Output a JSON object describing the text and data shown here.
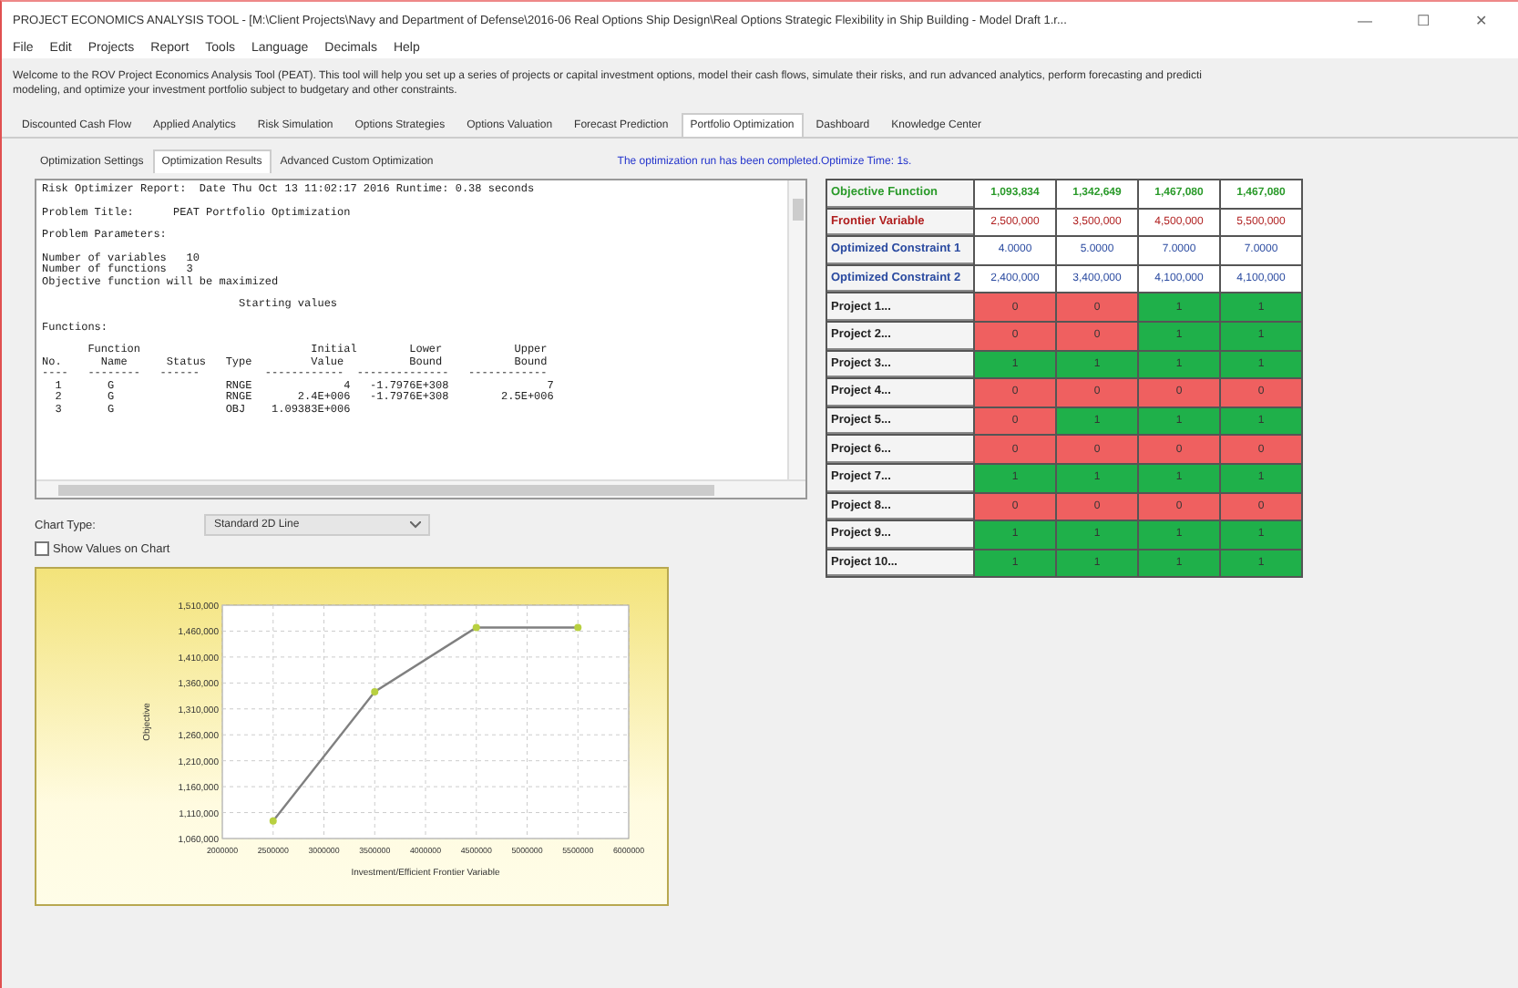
{
  "window": {
    "title": "PROJECT ECONOMICS ANALYSIS TOOL - [M:\\Client Projects\\Navy and Department of Defense\\2016-06 Real Options Ship Design\\Real Options Strategic Flexibility in Ship Building - Model Draft 1.r...",
    "controls": [
      "—",
      "☐",
      "✕"
    ]
  },
  "menu": [
    "File",
    "Edit",
    "Projects",
    "Report",
    "Tools",
    "Language",
    "Decimals",
    "Help"
  ],
  "welcome": [
    "Welcome to the ROV Project Economics Analysis Tool (PEAT). This tool will help you set up a series of projects or capital investment options, model their cash flows, simulate their risks, and run advanced analytics, perform forecasting and predicti",
    "modeling, and optimize your investment portfolio subject to budgetary and other constraints."
  ],
  "tabs": [
    {
      "label": "Discounted Cash Flow",
      "selected": false
    },
    {
      "label": "Applied Analytics",
      "selected": false
    },
    {
      "label": "Risk Simulation",
      "selected": false
    },
    {
      "label": "Options Strategies",
      "selected": false
    },
    {
      "label": "Options Valuation",
      "selected": false
    },
    {
      "label": "Forecast Prediction",
      "selected": false
    },
    {
      "label": "Portfolio Optimization",
      "selected": true
    },
    {
      "label": "Dashboard",
      "selected": false
    },
    {
      "label": "Knowledge Center",
      "selected": false
    }
  ],
  "subtabs": [
    {
      "label": "Optimization Settings",
      "selected": false
    },
    {
      "label": "Optimization Results",
      "selected": true
    },
    {
      "label": "Advanced Custom Optimization",
      "selected": false
    }
  ],
  "status_message": "The optimization run has been completed.Optimize Time: 1s.",
  "report": [
    [
      "Risk Optimizer Report:  Date Thu Oct 13 11:02:17 2016 Runtime: 0.38 seconds"
    ],
    [
      "Problem Title:      PEAT Portfolio Optimization"
    ],
    [
      "Problem Parameters:"
    ],
    [
      "Number of variables   10",
      "Number of functions   3",
      "Objective function will be maximized"
    ],
    [
      "                              Starting values"
    ],
    [
      "Functions:"
    ],
    [
      "       Function                          Initial        Lower           Upper",
      "No.      Name      Status   Type         Value          Bound           Bound",
      "----   --------   ------          ------------  --------------   ------------",
      "  1       G                 RNGE              4   -1.7976E+308               7",
      "  2       G                 RNGE       2.4E+006   -1.7976E+308        2.5E+006",
      "  3       G                 OBJ    1.09383E+006"
    ]
  ],
  "chart_type": {
    "label": "Chart Type:",
    "value": "Standard 2D Line"
  },
  "show_values": {
    "label": "Show Values on Chart",
    "checked": false
  },
  "results": {
    "header_rows": [
      {
        "kind": "objective",
        "label": "Objective Function",
        "values": [
          "1,093,834",
          "1,342,649",
          "1,467,080",
          "1,467,080"
        ]
      },
      {
        "kind": "frontier",
        "label": "Frontier Variable",
        "values": [
          "2,500,000",
          "3,500,000",
          "4,500,000",
          "5,500,000"
        ]
      },
      {
        "kind": "constraint",
        "label": "Optimized Constraint 1",
        "values": [
          "4.0000",
          "5.0000",
          "7.0000",
          "7.0000"
        ]
      },
      {
        "kind": "constraint",
        "label": "Optimized Constraint 2",
        "values": [
          "2,400,000",
          "3,400,000",
          "4,100,000",
          "4,100,000"
        ]
      }
    ],
    "projects": [
      {
        "label": "Project 1...",
        "cells": [
          {
            "value": "0",
            "included": false
          },
          {
            "value": "0",
            "included": false
          },
          {
            "value": "1",
            "included": true
          },
          {
            "value": "1",
            "included": true
          }
        ]
      },
      {
        "label": "Project 2...",
        "cells": [
          {
            "value": "0",
            "included": false
          },
          {
            "value": "0",
            "included": false
          },
          {
            "value": "1",
            "included": true
          },
          {
            "value": "1",
            "included": true
          }
        ]
      },
      {
        "label": "Project 3...",
        "cells": [
          {
            "value": "1",
            "included": true
          },
          {
            "value": "1",
            "included": true
          },
          {
            "value": "1",
            "included": true
          },
          {
            "value": "1",
            "included": true
          }
        ]
      },
      {
        "label": "Project 4...",
        "cells": [
          {
            "value": "0",
            "included": false
          },
          {
            "value": "0",
            "included": false
          },
          {
            "value": "0",
            "included": false
          },
          {
            "value": "0",
            "included": false
          }
        ]
      },
      {
        "label": "Project 5...",
        "cells": [
          {
            "value": "0",
            "included": false
          },
          {
            "value": "1",
            "included": true
          },
          {
            "value": "1",
            "included": true
          },
          {
            "value": "1",
            "included": true
          }
        ]
      },
      {
        "label": "Project 6...",
        "cells": [
          {
            "value": "0",
            "included": false
          },
          {
            "value": "0",
            "included": false
          },
          {
            "value": "0",
            "included": false
          },
          {
            "value": "0",
            "included": false
          }
        ]
      },
      {
        "label": "Project 7...",
        "cells": [
          {
            "value": "1",
            "included": true
          },
          {
            "value": "1",
            "included": true
          },
          {
            "value": "1",
            "included": true
          },
          {
            "value": "1",
            "included": true
          }
        ]
      },
      {
        "label": "Project 8...",
        "cells": [
          {
            "value": "0",
            "included": false
          },
          {
            "value": "0",
            "included": false
          },
          {
            "value": "0",
            "included": false
          },
          {
            "value": "0",
            "included": false
          }
        ]
      },
      {
        "label": "Project 9...",
        "cells": [
          {
            "value": "1",
            "included": true
          },
          {
            "value": "1",
            "included": true
          },
          {
            "value": "1",
            "included": true
          },
          {
            "value": "1",
            "included": true
          }
        ]
      },
      {
        "label": "Project 10...",
        "cells": [
          {
            "value": "1",
            "included": true
          },
          {
            "value": "1",
            "included": true
          },
          {
            "value": "1",
            "included": true
          },
          {
            "value": "1",
            "included": true
          }
        ]
      }
    ]
  },
  "chart": {
    "chart_data": {
      "type": "line",
      "xlabel": "Investment/Efficient Frontier Variable",
      "ylabel": "Objective",
      "x": [
        2500000,
        3500000,
        4500000,
        5500000
      ],
      "grid": true,
      "series": [
        {
          "color": "#808080",
          "marker": true,
          "values": [
            1094000,
            1343000,
            1467000,
            1467000
          ]
        }
      ],
      "xlim": [
        2000000,
        6000000
      ],
      "ylim": [
        1060000,
        1510000
      ],
      "xticks": [
        2000000,
        2500000,
        3000000,
        3500000,
        4000000,
        4500000,
        5000000,
        5500000,
        6000000
      ],
      "yticks": [
        {
          "value": 1060000,
          "label": "1,060,000"
        },
        {
          "value": 1110000,
          "label": "1,110,000"
        },
        {
          "value": 1160000,
          "label": "1,160,000"
        },
        {
          "value": 1210000,
          "label": "1,210,000"
        },
        {
          "value": 1260000,
          "label": "1,260,000"
        },
        {
          "value": 1310000,
          "label": "1,310,000"
        },
        {
          "value": 1360000,
          "label": "1,360,000"
        },
        {
          "value": 1410000,
          "label": "1,410,000"
        },
        {
          "value": 1460000,
          "label": "1,460,000"
        },
        {
          "value": 1510000,
          "label": "1,510,000"
        }
      ]
    }
  }
}
